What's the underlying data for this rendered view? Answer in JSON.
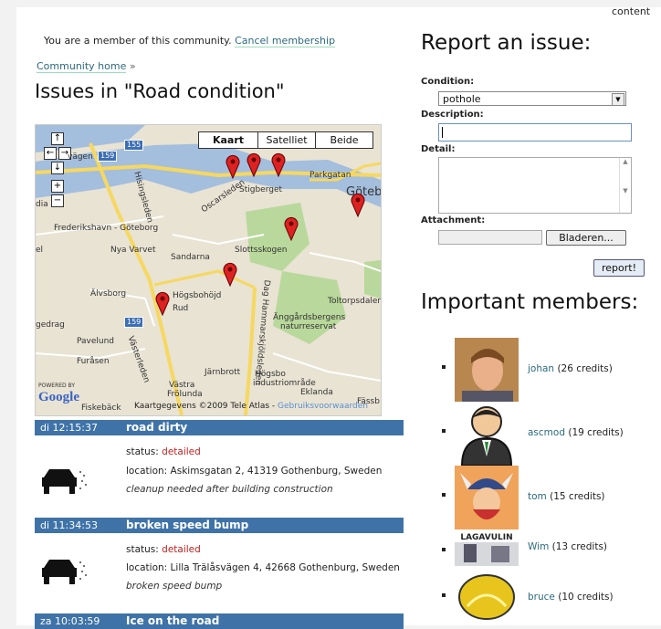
{
  "top_word": "content",
  "membership": {
    "text": "You are a member of this community.",
    "cancel_link": "Cancel membership"
  },
  "breadcrumb": {
    "home_link": "Community home",
    "separator": "»"
  },
  "page_title": "Issues in \"Road condition\"",
  "map": {
    "types": [
      "Kaart",
      "Satelliet",
      "Beide"
    ],
    "active_type": "Kaart",
    "controls": [
      "↑",
      "←",
      "→",
      "↓",
      "+",
      "−"
    ],
    "labels": {
      "stigberget": "Stigberget",
      "goteborg": "Göteb",
      "parkgatan": "Parkgatan",
      "frederikshavn": "Frederikshavn - Göteborg",
      "nya_varvet": "Nya Varvet",
      "sandarna": "Sandarna",
      "slottsskogen": "Slottsskogen",
      "alvsborg": "Älvsborg",
      "hogsbohojd": "Högsbohöjd",
      "rud": "Rud",
      "toltorpsdalen": "Toltorpsdalen",
      "angardsbergens": "Änggårdsbergens",
      "naturreservat": "naturreservat",
      "gedrag": "gedrag",
      "pavelund": "Pavelund",
      "furasen": "Furåsen",
      "jarnbrott": "Järnbrott",
      "hogsbo": "Högsbo",
      "industriomrade": "industriområde",
      "vastra": "Västra",
      "frolunda": "Frölunda",
      "ekanda": "Eklanda",
      "fiskeback": "Fiskebäck",
      "fass": "Fässb",
      "el": "el",
      "dia": "dia",
      "hisingsleden": "Hisingsleden",
      "oscarsleden": "Oscarsleden",
      "vastarleden": "Västerleden",
      "dag_hammarskjoldsleden": "Dag Hammarskjöldsleden",
      "vagen": "vägen"
    },
    "badges": [
      "155",
      "159",
      "159"
    ],
    "powered_by": "POWERED BY",
    "google": "Google",
    "copyright": "Kaartgegevens ©2009 Tele Atlas -",
    "terms_link": "Gebruiksvoorwaarden"
  },
  "issues": [
    {
      "time": "di 12:15:37",
      "title": "road dirty",
      "status_label": "status:",
      "status_value": "detailed",
      "location_label": "location:",
      "location": "Askimsgatan 2, 41319 Gothenburg, Sweden",
      "description": "cleanup needed after building construction"
    },
    {
      "time": "di 11:34:53",
      "title": "broken speed bump",
      "status_label": "status:",
      "status_value": "detailed",
      "location_label": "location:",
      "location": "Lilla Trälåsvägen 4, 42668 Gothenburg, Sweden",
      "description": "broken speed bump"
    },
    {
      "time": "za 10:03:59",
      "title": "Ice on the road"
    }
  ],
  "report": {
    "title": "Report an issue:",
    "condition_label": "Condition:",
    "condition_value": "pothole",
    "description_label": "Description:",
    "detail_label": "Detail:",
    "attachment_label": "Attachment:",
    "browse_button": "Bladeren...",
    "submit_button": "report!"
  },
  "members": {
    "title": "Important members:",
    "list": [
      {
        "name": "johan",
        "credits": "(26 credits)"
      },
      {
        "name": "ascmod",
        "credits": "(19 credits)"
      },
      {
        "name": "tom",
        "credits": "(15 credits)"
      },
      {
        "name": "Wim",
        "credits": "(13 credits)"
      },
      {
        "name": "bruce",
        "credits": "(10 credits)"
      }
    ],
    "wim_banner": "LAGAVULIN"
  },
  "colors": {
    "issue_header": "#3f73a8",
    "status": "#c02020",
    "link": "#2b6a7d",
    "map_bg": "#e8e3d3",
    "water": "#a4bedd",
    "park": "#b9d89b",
    "road_major": "#f6d860"
  }
}
